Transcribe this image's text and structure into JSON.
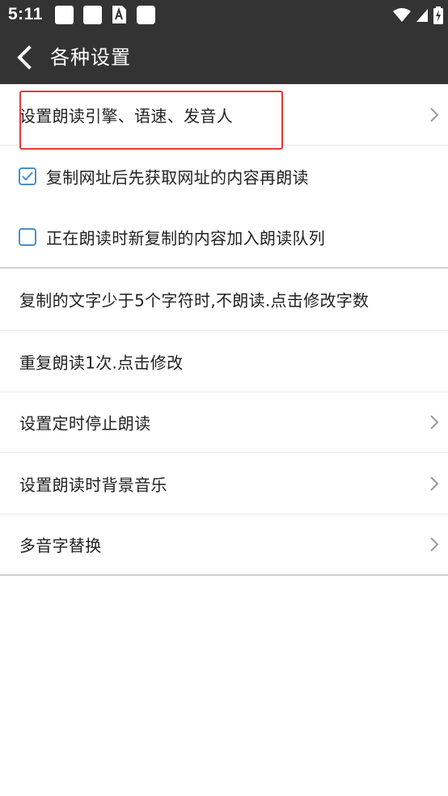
{
  "status_bar": {
    "time": "5:11",
    "notification_icons": [
      "square-notification-icon",
      "square-notification-icon",
      "sim-a-icon",
      "square-notification-icon"
    ],
    "system_icons": [
      "wifi-icon",
      "signal-icon",
      "battery-charging-icon"
    ]
  },
  "app_bar": {
    "title": "各种设置",
    "back_icon": "back-arrow-icon"
  },
  "settings": {
    "engine": {
      "label": "设置朗读引擎、语速、发音人",
      "has_chevron": true
    },
    "fetch_url": {
      "label": "复制网址后先获取网址的内容再朗读",
      "checked": true
    },
    "queue_new_copy": {
      "label": "正在朗读时新复制的内容加入朗读队列",
      "checked": false
    },
    "min_chars": {
      "label": "复制的文字少于5个字符时,不朗读.点击修改字数"
    },
    "repeat": {
      "label": "重复朗读1次.点击修改"
    },
    "timer": {
      "label": "设置定时停止朗读",
      "has_chevron": true
    },
    "bg_music": {
      "label": "设置朗读时背景音乐",
      "has_chevron": true
    },
    "polyphone": {
      "label": "多音字替换",
      "has_chevron": true
    }
  },
  "colors": {
    "bar": "#333333",
    "highlight": "#e53935",
    "checkbox": "#4a90c8"
  }
}
